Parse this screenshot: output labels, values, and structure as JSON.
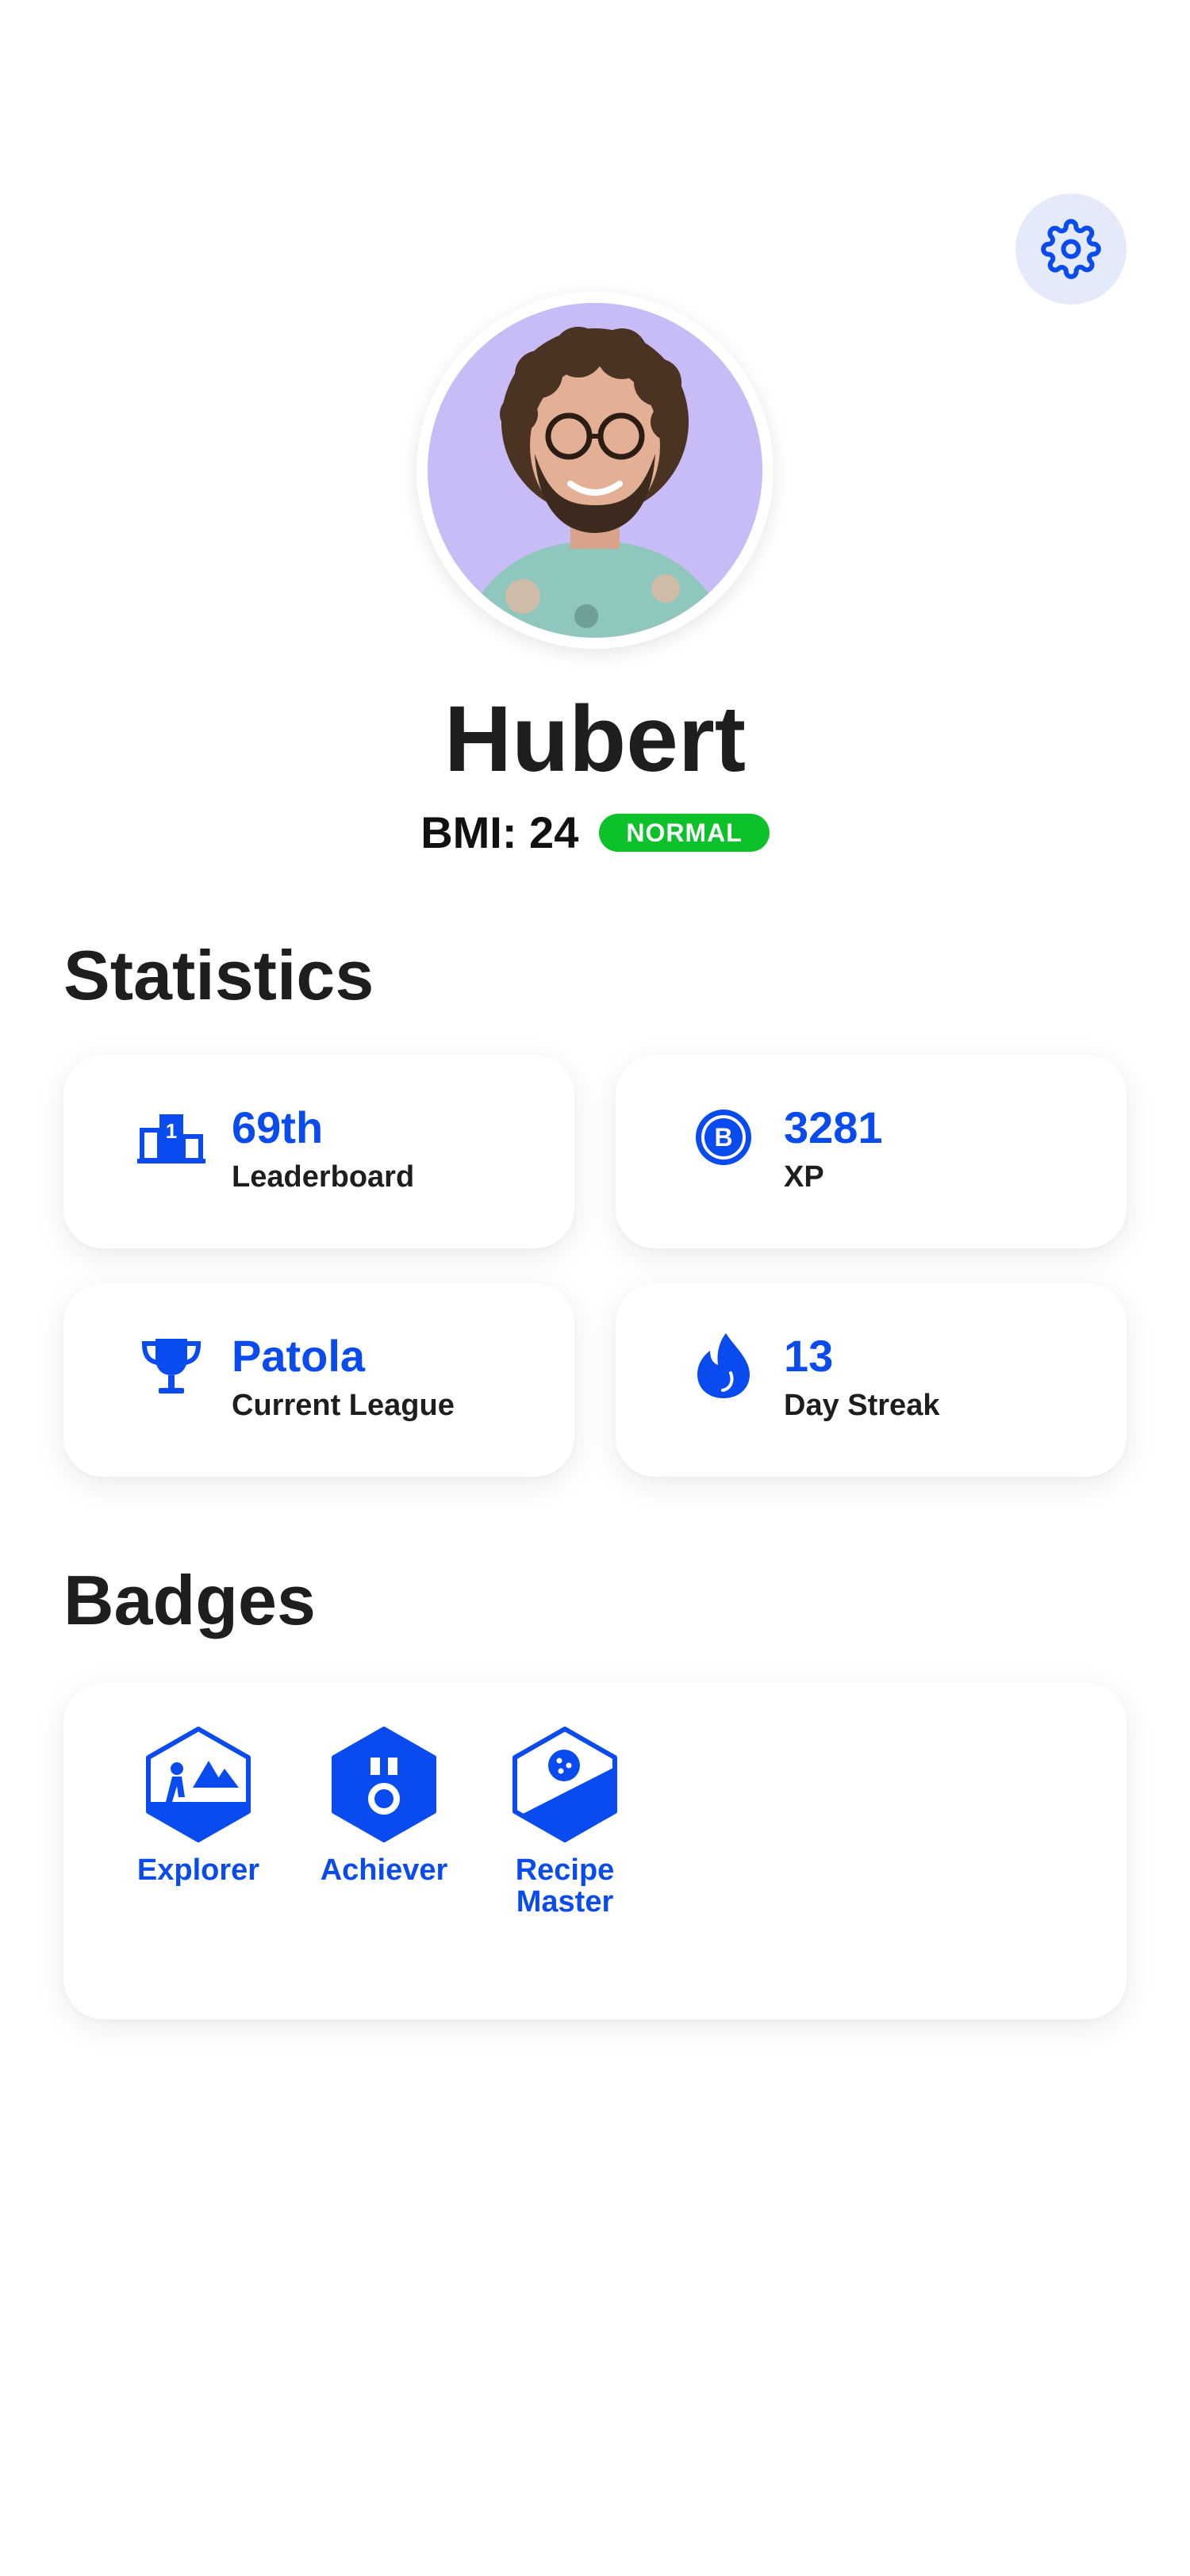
{
  "header": {
    "settings_icon": "gear-icon"
  },
  "profile": {
    "avatar": "avatar-photo",
    "name": "Hubert",
    "bmi_label": "BMI: 24",
    "bmi_status": "NORMAL",
    "bmi_status_color": "#0cc12a"
  },
  "statistics": {
    "title": "Statistics",
    "cards": [
      {
        "icon": "podium-icon",
        "value": "69th",
        "label": "Leaderboard"
      },
      {
        "icon": "xp-coin-icon",
        "value": "3281",
        "label": "XP"
      },
      {
        "icon": "trophy-icon",
        "value": "Patola",
        "label": "Current League"
      },
      {
        "icon": "flame-drop-icon",
        "value": "13",
        "label": "Day Streak"
      }
    ]
  },
  "badges": {
    "title": "Badges",
    "items": [
      {
        "icon": "explorer-badge-icon",
        "label": "Explorer"
      },
      {
        "icon": "achiever-badge-icon",
        "label": "Achiever"
      },
      {
        "icon": "recipe-master-badge-icon",
        "label": "Recipe Master"
      }
    ]
  },
  "colors": {
    "accent": "#0a4bf0",
    "settings_bg": "#e5eafb",
    "avatar_bg": "#c8bcf7"
  }
}
